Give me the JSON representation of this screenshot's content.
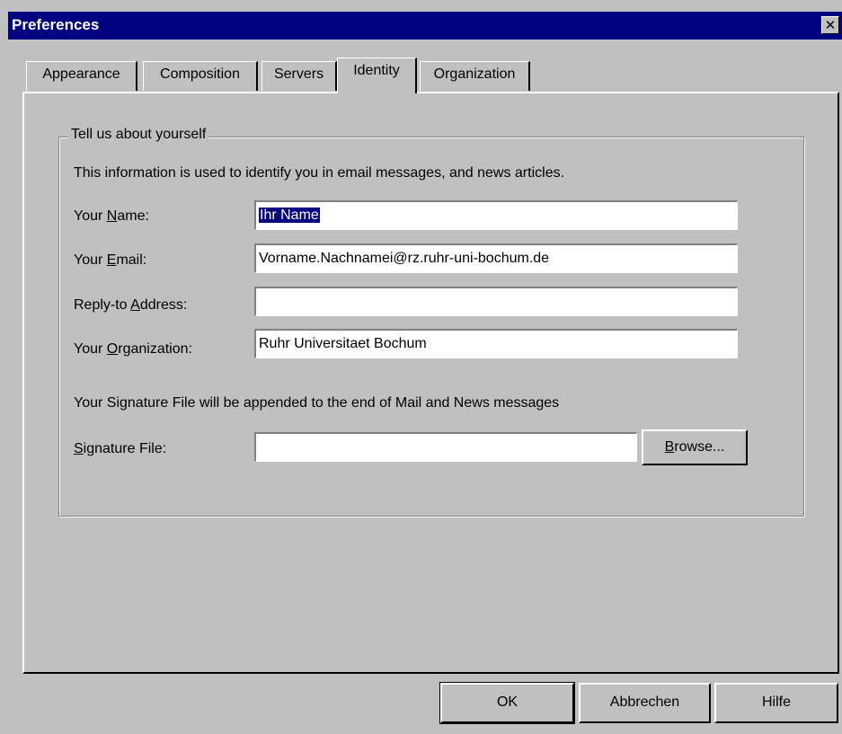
{
  "window": {
    "title": "Preferences",
    "close_label": "✕"
  },
  "tabs": [
    {
      "label": "Appearance"
    },
    {
      "label": "Composition"
    },
    {
      "label": "Servers"
    },
    {
      "label": "Identity",
      "active": true
    },
    {
      "label": "Organization"
    }
  ],
  "group": {
    "legend": "Tell us about yourself",
    "intro": "This information is used to identify you in email messages, and news articles.",
    "name_label": {
      "pre": "Your ",
      "key": "N",
      "post": "ame:"
    },
    "name_value": "Ihr Name",
    "email_label": {
      "pre": "Your ",
      "key": "E",
      "post": "mail:"
    },
    "email_value": "Vorname.Nachnamei@rz.ruhr-uni-bochum.de",
    "reply_label": {
      "pre": "Reply-to ",
      "key": "A",
      "post": "ddress:"
    },
    "reply_value": "",
    "org_label": {
      "pre": "Your ",
      "key": "O",
      "post": "rganization:"
    },
    "org_value": "Ruhr Universitaet Bochum",
    "sig_note": "Your Signature File will be appended to the end of Mail and News messages",
    "sig_label": {
      "pre": "",
      "key": "S",
      "post": "ignature File:"
    },
    "sig_value": "",
    "browse": {
      "key": "B",
      "post": "rowse..."
    }
  },
  "buttons": {
    "ok": "OK",
    "cancel": "Abbrechen",
    "help": "Hilfe"
  },
  "colors": {
    "titlebar": "#000080",
    "face": "#c0c0c0",
    "selection": "#000080"
  }
}
